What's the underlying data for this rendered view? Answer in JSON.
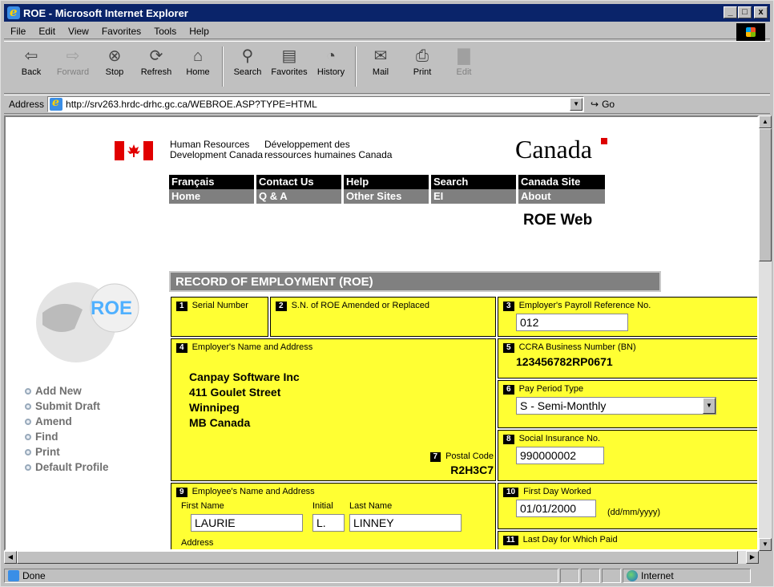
{
  "window": {
    "title": "ROE - Microsoft Internet Explorer",
    "buttons": {
      "min": "_",
      "max": "□",
      "close": "x"
    }
  },
  "menu": [
    "File",
    "Edit",
    "View",
    "Favorites",
    "Tools",
    "Help"
  ],
  "toolbar": [
    {
      "label": "Back",
      "icon": "⇦",
      "name": "back",
      "disabled": false
    },
    {
      "label": "Forward",
      "icon": "⇨",
      "name": "forward",
      "disabled": true
    },
    {
      "label": "Stop",
      "icon": "⊗",
      "name": "stop",
      "disabled": false
    },
    {
      "label": "Refresh",
      "icon": "⟳",
      "name": "refresh",
      "disabled": false
    },
    {
      "label": "Home",
      "icon": "⌂",
      "name": "home",
      "disabled": false
    },
    {
      "label": "Search",
      "icon": "⚲",
      "name": "search",
      "disabled": false
    },
    {
      "label": "Favorites",
      "icon": "▤",
      "name": "favorites",
      "disabled": false
    },
    {
      "label": "History",
      "icon": "◔",
      "name": "history",
      "disabled": false
    },
    {
      "label": "Mail",
      "icon": "✉",
      "name": "mail",
      "disabled": false
    },
    {
      "label": "Print",
      "icon": "⎙",
      "name": "print",
      "disabled": false
    },
    {
      "label": "Edit",
      "icon": "▇",
      "name": "edit",
      "disabled": true
    }
  ],
  "address": {
    "label": "Address",
    "url": "http://srv263.hrdc-drhc.gc.ca/WEBROE.ASP?TYPE=HTML",
    "go": "Go"
  },
  "header": {
    "hrdc_en_1": "Human Resources",
    "hrdc_en_2": "Development Canada",
    "hrdc_fr_1": "Développement des",
    "hrdc_fr_2": "ressources humaines Canada",
    "wordmark": "Canada"
  },
  "nav": {
    "top": [
      "Français",
      "Contact Us",
      "Help",
      "Search",
      "Canada Site"
    ],
    "bottom": [
      "Home",
      "Q & A",
      "Other Sites",
      "EI",
      "About"
    ]
  },
  "roe_web": "ROE Web",
  "roe_logo_text": "ROE",
  "sidemenu": [
    "Add New",
    "Submit Draft",
    "Amend",
    "Find",
    "Print",
    "Default Profile"
  ],
  "form": {
    "title": "RECORD OF EMPLOYMENT (ROE)",
    "b1": {
      "num": "1",
      "label": "Serial Number"
    },
    "b2": {
      "num": "2",
      "label": "S.N. of ROE Amended or Replaced"
    },
    "b3": {
      "num": "3",
      "label": "Employer's Payroll Reference No.",
      "value": "012"
    },
    "b4": {
      "num": "4",
      "label": "Employer's Name and Address",
      "lines": [
        "Canpay Software Inc",
        "411 Goulet Street",
        "Winnipeg",
        "MB Canada"
      ]
    },
    "b5": {
      "num": "5",
      "label": "CCRA Business Number (BN)",
      "value": "123456782RP0671"
    },
    "b6": {
      "num": "6",
      "label": "Pay Period Type",
      "value": "S - Semi-Monthly"
    },
    "b7": {
      "num": "7",
      "label": "Postal Code",
      "value": "R2H3C7"
    },
    "b8": {
      "num": "8",
      "label": "Social Insurance No.",
      "value": "990000002"
    },
    "b9": {
      "num": "9",
      "label": "Employee's Name and Address",
      "first_label": "First Name",
      "initial_label": "Initial",
      "last_label": "Last Name",
      "first": "LAURIE",
      "initial": "L.",
      "last": "LINNEY",
      "address_label": "Address"
    },
    "b10": {
      "num": "10",
      "label": "First Day Worked",
      "value": "01/01/2000",
      "hint": "(dd/mm/yyyy)"
    },
    "b11": {
      "num": "11",
      "label": "Last Day for Which Paid"
    }
  },
  "status": {
    "text": "Done",
    "zone": "Internet"
  }
}
